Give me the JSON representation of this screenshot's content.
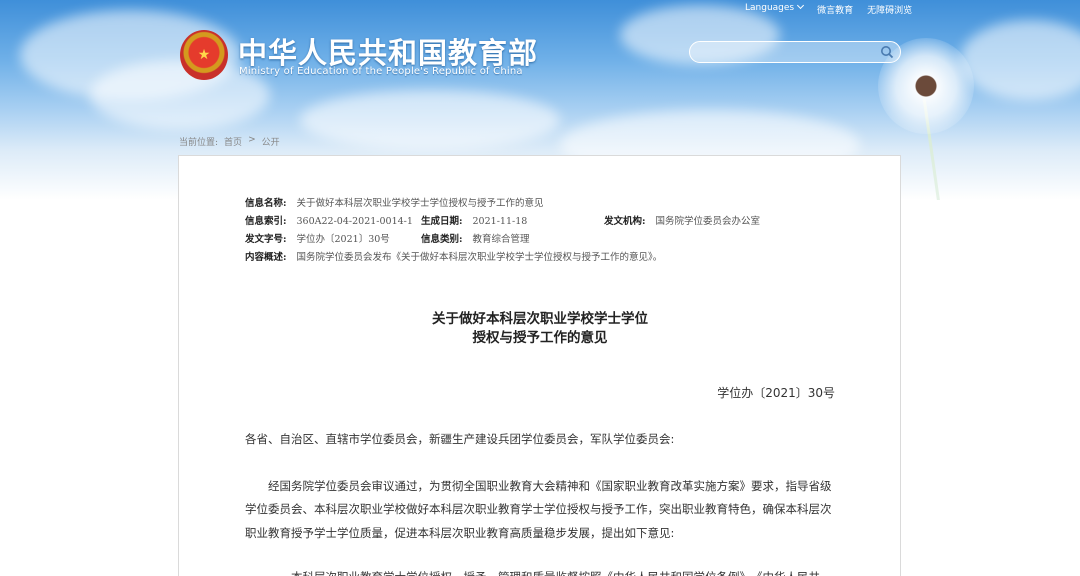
{
  "header": {
    "languages": "Languages",
    "wechat": "微言教育",
    "accessibility": "无障碍浏览",
    "title": "中华人民共和国教育部",
    "subtitle": "Ministry of Education of the People's Republic of China",
    "search_placeholder": ""
  },
  "breadcrumb": {
    "label": "当前位置:",
    "home": "首页",
    "sep": ">",
    "current": "公开"
  },
  "meta": {
    "name_label": "信息名称:",
    "name_value": "关于做好本科层次职业学校学士学位授权与授予工作的意见",
    "index_label": "信息索引:",
    "index_value": "360A22-04-2021-0014-1",
    "date_label": "生成日期:",
    "date_value": "2021-11-18",
    "org_label": "发文机构:",
    "org_value": "国务院学位委员会办公室",
    "docno_label": "发文字号:",
    "docno_value": "学位办〔2021〕30号",
    "category_label": "信息类别:",
    "category_value": "教育综合管理",
    "summary_label": "内容概述:",
    "summary_value": "国务院学位委员会发布《关于做好本科层次职业学校学士学位授权与授予工作的意见》。"
  },
  "document": {
    "title_line1": "关于做好本科层次职业学校学士学位",
    "title_line2": "授权与授予工作的意见",
    "number": "学位办〔2021〕30号",
    "salutation": "各省、自治区、直辖市学位委员会，新疆生产建设兵团学位委员会，军队学位委员会:",
    "paragraph1": "经国务院学位委员会审议通过，为贯彻全国职业教育大会精神和《国家职业教育改革实施方案》要求，指导省级学位委员会、本科层次职业学校做好本科层次职业教育学士学位授权与授予工作，突出职业教育特色，确保本科层次职业教育授予学士学位质量，促进本科层次职业教育高质量稳步发展，提出如下意见:",
    "paragraph2": "一、本科层次职业教育学士学位授权、授予、管理和质量监督按照《中华人民共和国学位条例》、《中华人民共"
  },
  "colors": {
    "accent": "#3f8fd9",
    "panel_border": "#dadada"
  }
}
